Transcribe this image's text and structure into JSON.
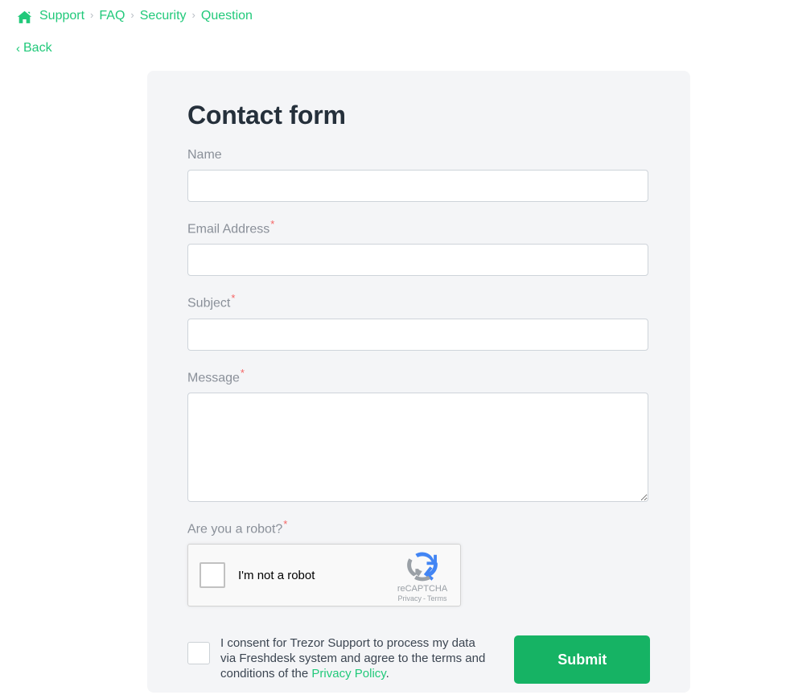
{
  "breadcrumb": {
    "home_icon": "home-icon",
    "separator": "›",
    "items": [
      {
        "label": "Support"
      },
      {
        "label": "FAQ"
      },
      {
        "label": "Security"
      },
      {
        "label": "Question"
      }
    ]
  },
  "back": {
    "chevron": "‹",
    "label": "Back"
  },
  "form": {
    "title": "Contact form",
    "fields": {
      "name": {
        "label": "Name",
        "value": "",
        "placeholder": "",
        "required": false
      },
      "email": {
        "label": "Email Address",
        "value": "",
        "placeholder": "",
        "required": true,
        "required_mark": "*"
      },
      "subject": {
        "label": "Subject",
        "value": "",
        "placeholder": "",
        "required": true,
        "required_mark": "*"
      },
      "message": {
        "label": "Message",
        "value": "",
        "placeholder": "",
        "required": true,
        "required_mark": "*"
      },
      "robot": {
        "label": "Are you a robot?",
        "required": true,
        "required_mark": "*"
      }
    },
    "recaptcha": {
      "checkbox_label": "I'm not a robot",
      "brand_name": "reCAPTCHA",
      "privacy_label": "Privacy",
      "separator": "-",
      "terms_label": "Terms",
      "logo_icon": "recaptcha-logo-icon"
    },
    "consent": {
      "text_before": "I consent for Trezor Support to process my data via Freshdesk system and agree to the terms and conditions of the ",
      "link_label": "Privacy Policy",
      "text_after": "."
    },
    "submit_label": "Submit"
  },
  "colors": {
    "accent_green": "#21c97a",
    "submit_green": "#16b364",
    "required_red": "#f56565",
    "label_gray": "#8a9099",
    "card_bg": "#f4f5f7",
    "title_dark": "#25303b",
    "recaptcha_blue": "#4285f4",
    "recaptcha_gray": "#9aa0a6"
  }
}
